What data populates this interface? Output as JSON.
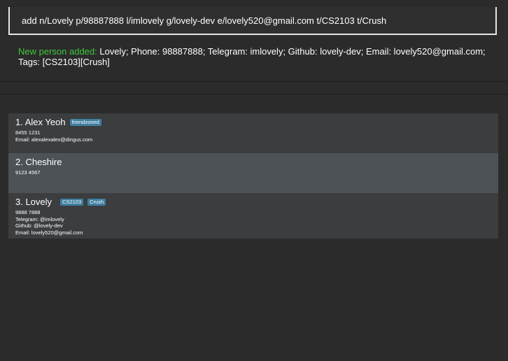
{
  "command_box": {
    "text": "add n/Lovely p/98887888 l/imlovely g/lovely-dev e/lovely520@gmail.com t/CS2103 t/Crush"
  },
  "result": {
    "prefix": "New person added:",
    "line1": " Lovely; Phone: 98887888; Telegram: imlovely;  Github: lovely-dev; Email: lovely520@gmail.com;",
    "line2": "Tags: [CS2103][Crush]"
  },
  "persons": [
    {
      "title": "1. Alex Yeoh",
      "tags": [
        "friendzoned"
      ],
      "details": [
        "8455 1231",
        "Email: alexalexalex@dingus.com"
      ]
    },
    {
      "title": "2. Cheshire",
      "tags": [],
      "details": [
        "9123 4567"
      ]
    },
    {
      "title": "3. Lovely",
      "tags": [
        "CS2103",
        "Crush"
      ],
      "details": [
        "9888 7888",
        "Telegram: @imlovely",
        "Github: @lovely-dev",
        "Email: lovely520@gmail.com"
      ]
    }
  ],
  "colors": {
    "background": "#2b2b2b",
    "result_accent": "#3ec93e",
    "tag_bg": "#3f7fa0",
    "card_bg": "#3b3d3f",
    "card_selected_bg": "#4d5256"
  }
}
